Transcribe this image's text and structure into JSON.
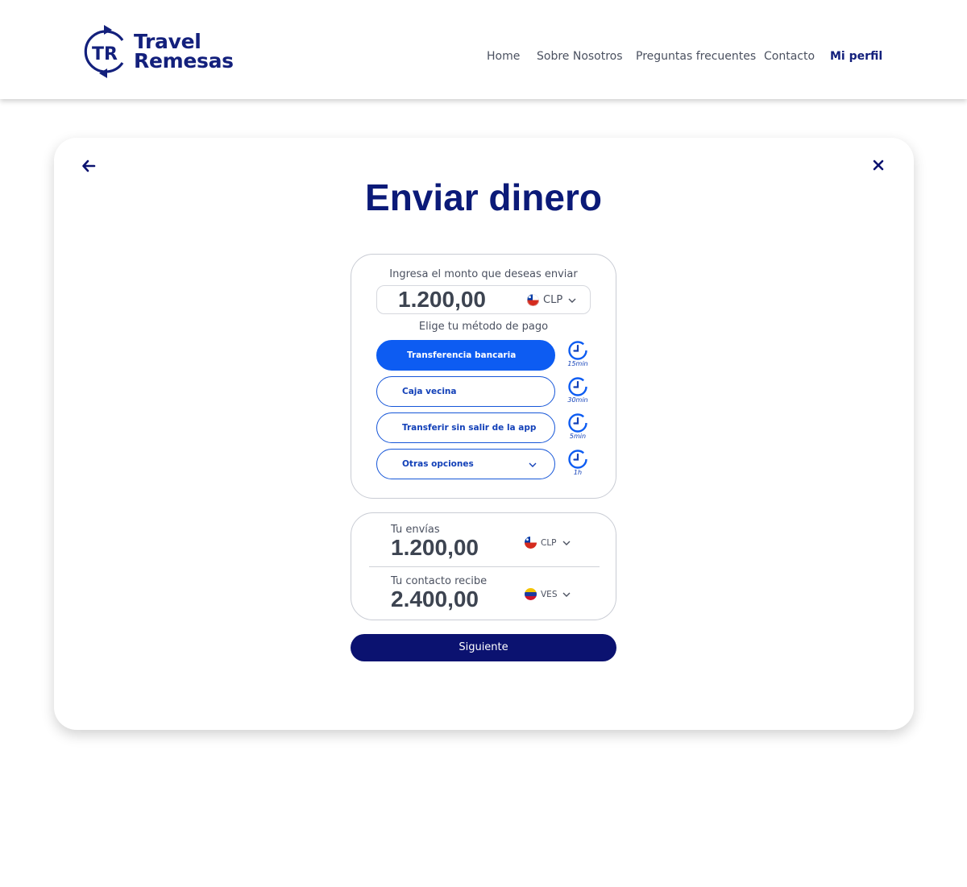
{
  "brand": {
    "initials": "TR",
    "line1": "Travel",
    "line2": "Remesas",
    "color": "#13207c"
  },
  "nav": {
    "items": [
      "Home",
      "Sobre Nosotros",
      "Preguntas frecuentes",
      "Contacto",
      "Mi perfil"
    ],
    "active": "Mi perfil"
  },
  "page": {
    "title": "Enviar dinero"
  },
  "amount": {
    "label": "Ingresa el monto que deseas enviar",
    "value": "1.200,00",
    "currency": "CLP"
  },
  "payment": {
    "label": "Elige tu método de pago",
    "methods": [
      {
        "label": "Transferencia bancaria",
        "time": "15min",
        "selected": true
      },
      {
        "label": "Caja vecina",
        "time": "30min",
        "selected": false
      },
      {
        "label": "Transferir sin salir de la app",
        "time": "5min",
        "selected": false
      },
      {
        "label": "Otras opciones",
        "time": "1h",
        "selected": false
      }
    ]
  },
  "summary": {
    "send_label": "Tu envías",
    "send_value": "1.200,00",
    "send_currency": "CLP",
    "receive_label": "Tu contacto recibe",
    "receive_value": "2.400,00",
    "receive_currency": "VES"
  },
  "actions": {
    "next_label": "Siguiente"
  },
  "colors": {
    "primary": "#0b1270",
    "accent": "#0d5cf2",
    "title": "#0b1a78"
  },
  "icons": [
    "logo-icon",
    "back-arrow-icon",
    "close-icon",
    "chile-flag-icon",
    "venezuela-flag-icon",
    "chevron-down-icon",
    "timer-icon"
  ]
}
